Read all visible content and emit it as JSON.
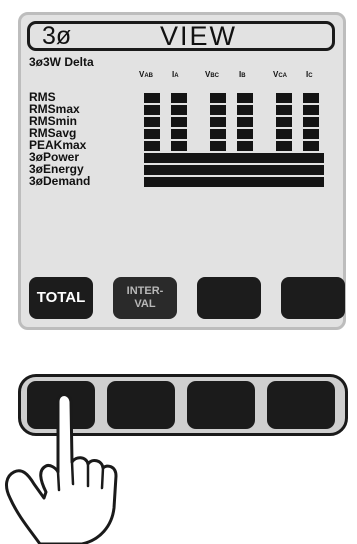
{
  "screen": {
    "title_mode": "3ø",
    "title": "VIEW",
    "wiring": "3ø3W Delta",
    "columns": [
      {
        "main": "V",
        "sub": "AB"
      },
      {
        "main": "I",
        "sub": "A"
      },
      {
        "main": "V",
        "sub": "BC"
      },
      {
        "main": "I",
        "sub": "B"
      },
      {
        "main": "V",
        "sub": "CA"
      },
      {
        "main": "I",
        "sub": "C"
      }
    ],
    "rows": [
      "RMS",
      "RMSmax",
      "RMSmin",
      "RMSavg",
      "PEAKmax"
    ],
    "total_rows": [
      "3øPower",
      "3øEnergy",
      "3øDemand"
    ]
  },
  "softkeys": [
    {
      "label": "TOTAL"
    },
    {
      "label": "INTER-\nVAL"
    },
    {
      "label": ""
    },
    {
      "label": ""
    }
  ],
  "hardware_keys": [
    "",
    "",
    "",
    ""
  ],
  "colors": {
    "lcd_background": "#e2e2e2",
    "segment": "#141414",
    "key": "#1b1b1b"
  }
}
